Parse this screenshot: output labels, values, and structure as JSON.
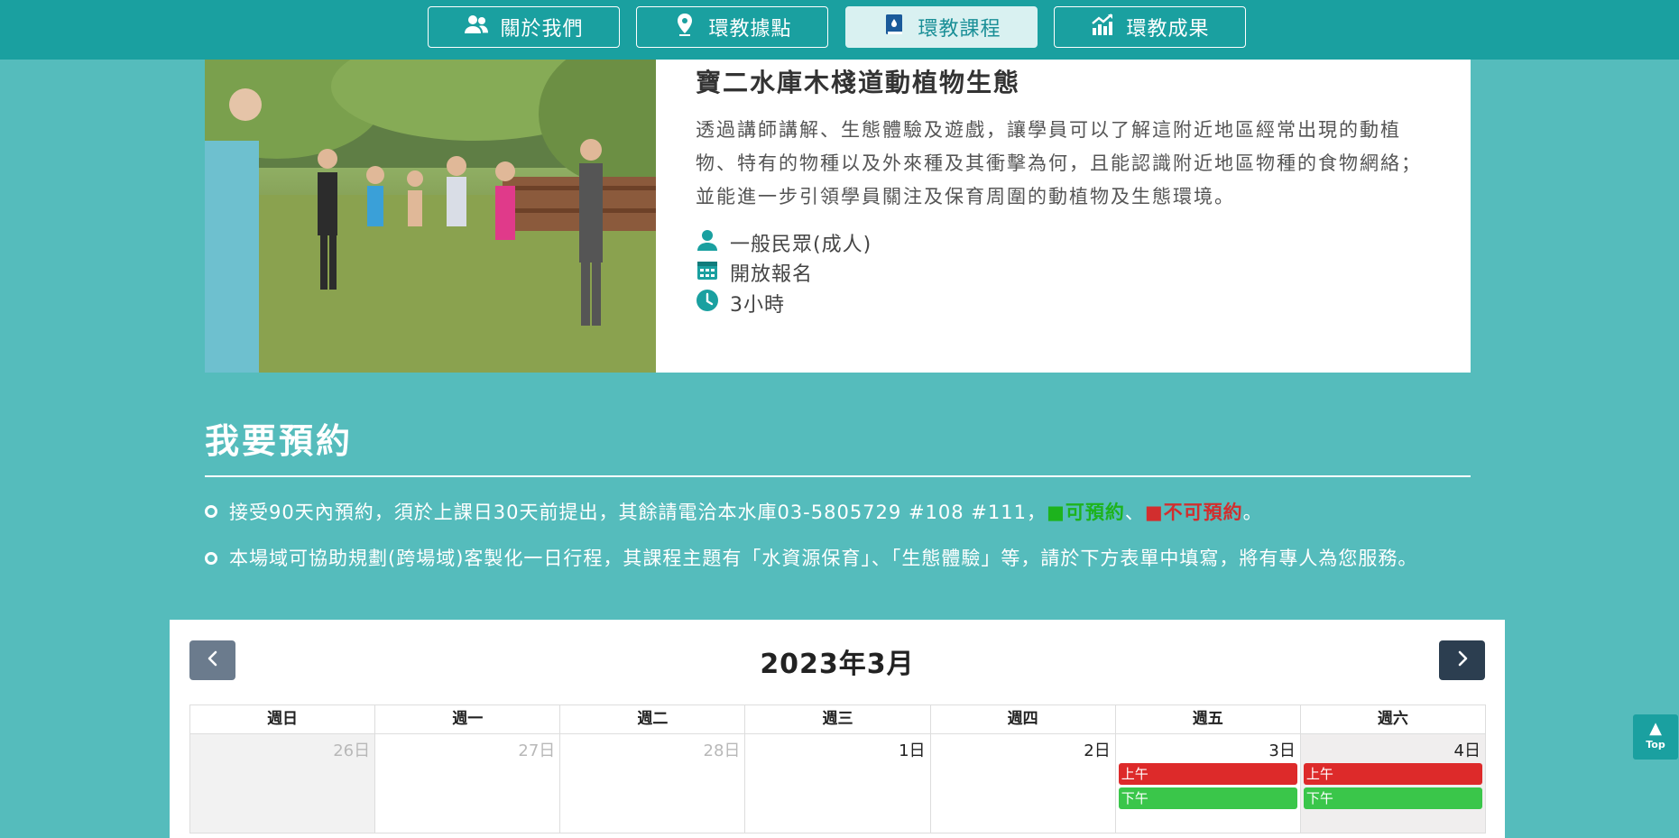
{
  "nav": {
    "items": [
      {
        "label": "關於我們",
        "icon": "users-icon"
      },
      {
        "label": "環教據點",
        "icon": "map-pin-icon"
      },
      {
        "label": "環教課程",
        "icon": "book-drop-icon",
        "active": true
      },
      {
        "label": "環教成果",
        "icon": "chart-up-icon"
      }
    ]
  },
  "course": {
    "title": "寶二水庫木棧道動植物生態",
    "description": "透過講師講解、生態體驗及遊戲，讓學員可以了解這附近地區經常出現的動植物、特有的物種以及外來種及其衝擊為何，且能認識附近地區物種的食物網絡；並能進一步引領學員關注及保育周圍的動植物及生態環境。",
    "audience": "一般民眾(成人)",
    "enrollment": "開放報名",
    "duration": "3小時"
  },
  "booking": {
    "title": "我要預約",
    "note1_text": "接受90天內預約，須於上課日30天前提出，其餘請電洽本水庫03-5805729 #108 #111，",
    "note1_available": "■可預約",
    "note1_sep": "、",
    "note1_unavailable": "■不可預約",
    "note1_end": "。",
    "note2": "本場域可協助規劃(跨場域)客製化一日行程，其課程主題有「水資源保育」、「生態體驗」等，請於下方表單中填寫，將有專人為您服務。"
  },
  "calendar": {
    "title": "2023年3月",
    "weekdays": [
      "週日",
      "週一",
      "週二",
      "週三",
      "週四",
      "週五",
      "週六"
    ],
    "days": [
      {
        "label": "26日",
        "other": true
      },
      {
        "label": "27日",
        "other": true
      },
      {
        "label": "28日",
        "other": true
      },
      {
        "label": "1日"
      },
      {
        "label": "2日"
      },
      {
        "label": "3日",
        "morning": "上午",
        "afternoon": "下午"
      },
      {
        "label": "4日",
        "morning": "上午",
        "afternoon": "下午"
      }
    ]
  },
  "colors": {
    "available": "#3ac64a",
    "unavailable": "#dd2a2a"
  },
  "top_button": {
    "label": "Top"
  }
}
